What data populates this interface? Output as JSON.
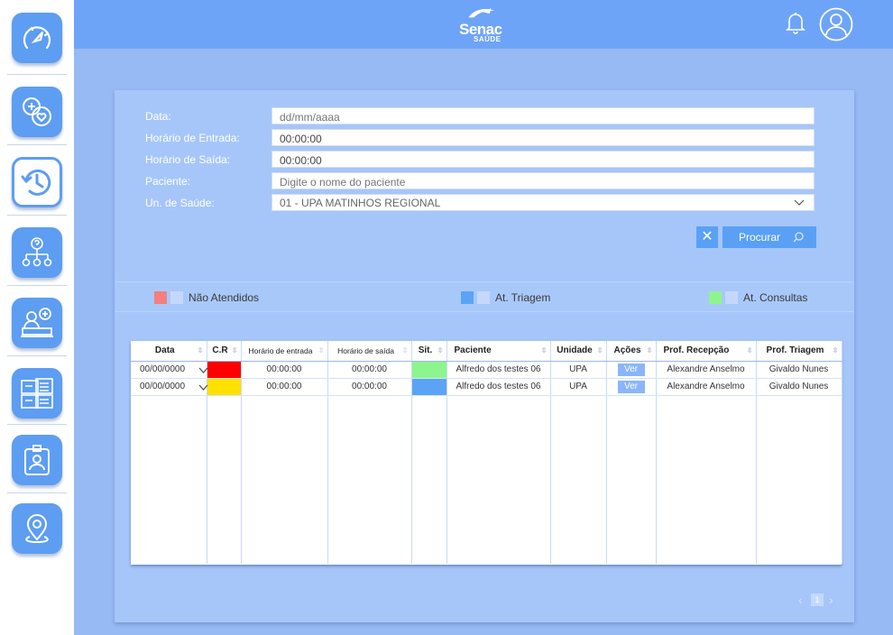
{
  "sidebar": {
    "items": [
      {
        "icon": "speedometer-icon"
      },
      {
        "icon": "health-chat-icon"
      },
      {
        "icon": "history-icon"
      },
      {
        "icon": "question-hierarchy-icon"
      },
      {
        "icon": "reception-desk-icon"
      },
      {
        "icon": "boards-icon"
      },
      {
        "icon": "badge-icon"
      },
      {
        "icon": "location-pin-icon"
      }
    ]
  },
  "header": {
    "logo_brand": "Senac",
    "logo_sub": "SAÚDE",
    "icons": [
      "bell-icon",
      "user-avatar-icon"
    ]
  },
  "form": {
    "fields": [
      {
        "label": "Data:",
        "placeholder": "dd/mm/aaaa",
        "value": ""
      },
      {
        "label": "Horário de Entrada:",
        "placeholder": "",
        "value": "00:00:00"
      },
      {
        "label": "Horário de Saída:",
        "placeholder": "",
        "value": "00:00:00"
      },
      {
        "label": "Paciente:",
        "placeholder": "Digite o nome do paciente",
        "value": ""
      },
      {
        "label": "Un. de Saúde:",
        "placeholder": "",
        "value": "01 - UPA MATINHOS REGIONAL"
      }
    ],
    "clear_label": "✕",
    "search_label": "Procurar"
  },
  "legend": [
    {
      "label": "Não Atendidos",
      "color": "#f47f7f"
    },
    {
      "label": "At. Triagem",
      "color": "#5ba4f5"
    },
    {
      "label": "At. Consultas",
      "color": "#8df58d"
    }
  ],
  "table": {
    "columns": [
      "Data",
      "C.R",
      "Horário de entrada",
      "Horário de saída",
      "Sit.",
      "Paciente",
      "Unidade",
      "Ações",
      "Prof. Recepção",
      "Prof. Triagem"
    ],
    "rows": [
      {
        "data": "00/00/0000",
        "cr_color": "#ff0000",
        "entrada": "00:00:00",
        "saida": "00:00:00",
        "sit_color": "#8df58d",
        "paciente": "Alfredo dos testes 06",
        "unidade": "UPA",
        "acao": "Ver",
        "recepcao": "Alexandre Anselmo",
        "triagem": "Givaldo Nunes"
      },
      {
        "data": "00/00/0000",
        "cr_color": "#ffe100",
        "entrada": "00:00:00",
        "saida": "00:00:00",
        "sit_color": "#5ba4f5",
        "paciente": "Alfredo dos testes 06",
        "unidade": "UPA",
        "acao": "Ver",
        "recepcao": "Alexandre Anselmo",
        "triagem": "Givaldo Nunes"
      }
    ]
  },
  "pager": {
    "prev": "‹",
    "current": "1",
    "next": "›"
  }
}
